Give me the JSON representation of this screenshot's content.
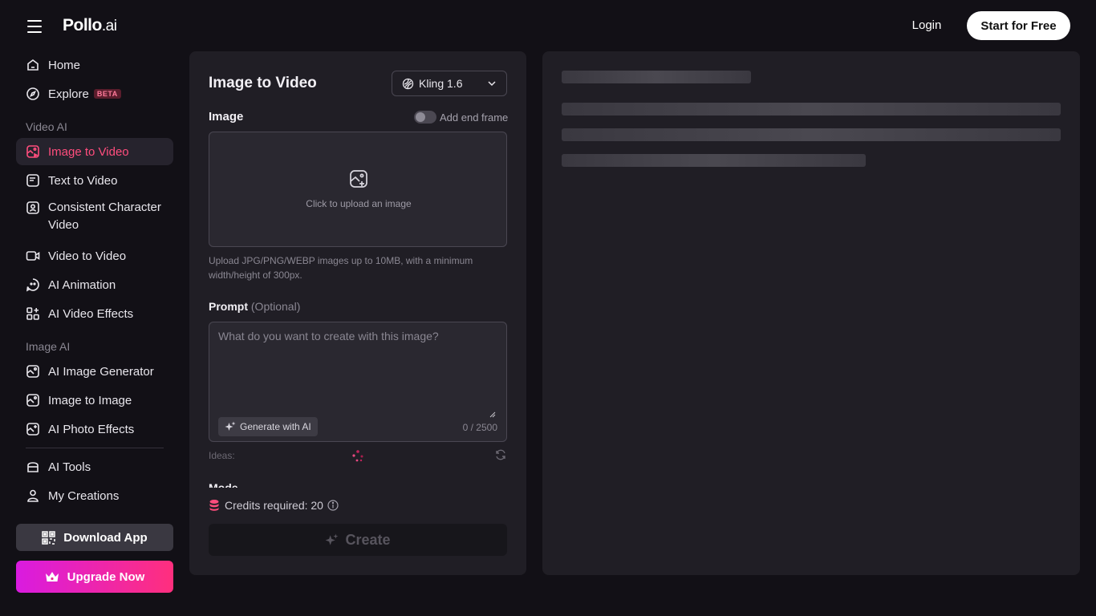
{
  "header": {
    "logo_main": "Pollo",
    "logo_suffix": ".ai",
    "login_label": "Login",
    "start_label": "Start for Free"
  },
  "sidebar": {
    "home": "Home",
    "explore": "Explore",
    "explore_badge": "BETA",
    "video_section": "Video AI",
    "video_items": [
      "Image to Video",
      "Text to Video",
      "Consistent Character Video",
      "Video to Video",
      "AI Animation",
      "AI Video Effects"
    ],
    "image_section": "Image AI",
    "image_items": [
      "AI Image Generator",
      "Image to Image",
      "AI Photo Effects"
    ],
    "tools": "AI Tools",
    "creations": "My Creations",
    "download_label": "Download App",
    "upgrade_label": "Upgrade Now"
  },
  "panel": {
    "title": "Image to Video",
    "model": "Kling 1.6",
    "image_label": "Image",
    "end_frame_label": "Add end frame",
    "upload_text": "Click to upload an image",
    "upload_hint": "Upload JPG/PNG/WEBP images up to 10MB, with a minimum width/height of 300px.",
    "prompt_label": "Prompt",
    "prompt_optional": "(Optional)",
    "prompt_placeholder": "What do you want to create with this image?",
    "generate_ai_label": "Generate with AI",
    "char_counter": "0 / 2500",
    "ideas_label": "Ideas:",
    "mode_label": "Mode",
    "credits_label": "Credits required: 20",
    "create_label": "Create"
  },
  "colors": {
    "accent": "#ff4d7d",
    "upgrade_gradient_start": "#d91be0",
    "upgrade_gradient_end": "#ff2f7d",
    "background": "#121016",
    "panel": "#201e25"
  }
}
